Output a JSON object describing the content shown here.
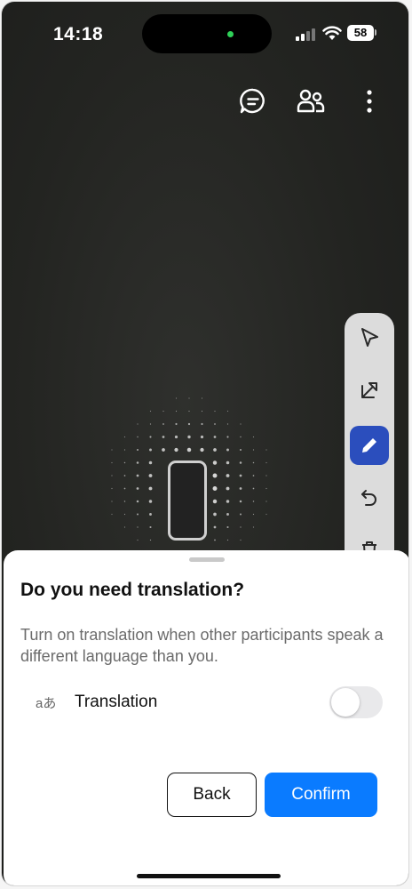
{
  "status_bar": {
    "time": "14:18",
    "battery": "58",
    "signal_icon": "cellular-signal-icon",
    "wifi_icon": "wifi-icon"
  },
  "top_bar": {
    "icons": [
      "chat-icon",
      "participants-icon",
      "more-vertical-icon"
    ]
  },
  "toolbar": {
    "tools": [
      "pointer-icon",
      "arrow-icon",
      "pen-icon",
      "undo-icon",
      "trash-icon"
    ],
    "active_tool": "pen-icon",
    "active_color": "#2b4ebd"
  },
  "sheet": {
    "title": "Do you need translation?",
    "description": "Turn on translation when other participants speak a different language than you.",
    "translation_icon_text": "aあ",
    "translation_label": "Translation",
    "translation_enabled": false,
    "back_label": "Back",
    "confirm_label": "Confirm",
    "confirm_color": "#0a7bff"
  }
}
